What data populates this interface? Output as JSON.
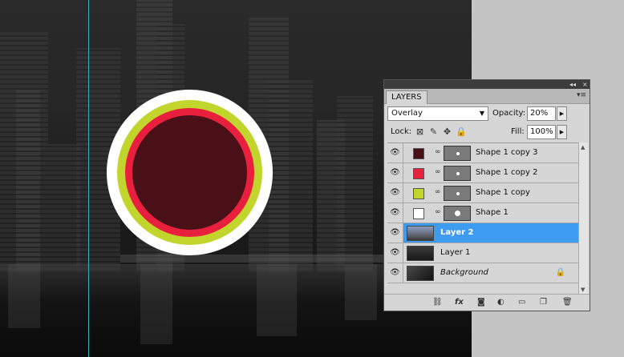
{
  "panel": {
    "tab_label": "LAYERS",
    "collapse_label": "◂◂",
    "close_label": "×",
    "menu_label": "▾≡",
    "blend_mode": "Overlay",
    "opacity_label": "Opacity:",
    "opacity_value": "20%",
    "lock_label": "Lock:",
    "fill_label": "Fill:",
    "fill_value": "100%",
    "layers": [
      {
        "name": "Shape 1 copy 3",
        "swatch": "#4a1018"
      },
      {
        "name": "Shape 1 copy 2",
        "swatch": "#e8203e"
      },
      {
        "name": "Shape 1 copy",
        "swatch": "#c2d52c"
      },
      {
        "name": "Shape 1",
        "swatch": "#ffffff"
      },
      {
        "name": "Layer 2",
        "selected": true
      },
      {
        "name": "Layer 1"
      },
      {
        "name": "Background"
      }
    ]
  },
  "colors": {
    "outer_ring": "#ffffff",
    "ring2": "#c2d52c",
    "ring3": "#e8203e",
    "core": "#4a1018",
    "guide": "#2fb3b3",
    "selection": "#3d9cf0"
  },
  "icons": {
    "eye": "eye-icon",
    "link": "chain-link-icon",
    "lock": "padlock-icon",
    "footer": [
      "link-layers-icon",
      "fx-icon",
      "add-mask-icon",
      "adjustment-layer-icon",
      "group-folder-icon",
      "new-layer-icon",
      "trash-icon"
    ]
  }
}
